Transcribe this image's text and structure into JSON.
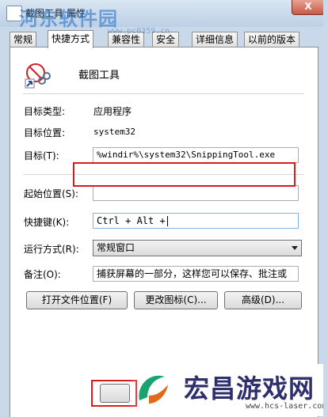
{
  "window": {
    "title": "截图工具 属性",
    "close_label": "X"
  },
  "watermark": {
    "site_name": "河东软件园",
    "site_url": "www.pc0359.cn"
  },
  "tabs": [
    {
      "label": "常规"
    },
    {
      "label": "快捷方式"
    },
    {
      "label": "兼容性"
    },
    {
      "label": "安全"
    },
    {
      "label": "详细信息"
    },
    {
      "label": "以前的版本"
    }
  ],
  "shortcut": {
    "app_name": "截图工具",
    "target_type_label": "目标类型:",
    "target_type_value": "应用程序",
    "target_location_label": "目标位置:",
    "target_location_value": "system32",
    "target_label": "目标(T):",
    "target_value": "%windir%\\system32\\SnippingTool.exe",
    "start_in_label": "起始位置(S):",
    "start_in_value": "",
    "hotkey_label": "快捷键(K):",
    "hotkey_value": "Ctrl + Alt +",
    "run_label": "运行方式(R):",
    "run_value": "常规窗口",
    "comment_label": "备注(O):",
    "comment_value": "捕获屏幕的一部分，这样您可以保存、批注或",
    "open_location_button": "打开文件位置(F)",
    "change_icon_button": "更改图标(C)...",
    "advanced_button": "高级(D)..."
  },
  "branding": {
    "name": "宏昌游戏网",
    "url": "www.hcs-laser.com"
  },
  "colors": {
    "highlight_red": "#d71a1a",
    "watermark_blue": "#1e6ec8"
  }
}
